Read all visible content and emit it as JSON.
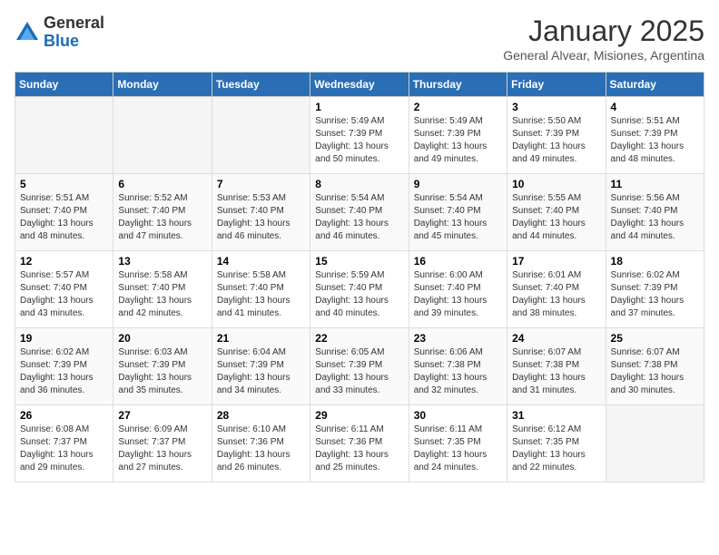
{
  "logo": {
    "general": "General",
    "blue": "Blue"
  },
  "title": "January 2025",
  "subtitle": "General Alvear, Misiones, Argentina",
  "days_of_week": [
    "Sunday",
    "Monday",
    "Tuesday",
    "Wednesday",
    "Thursday",
    "Friday",
    "Saturday"
  ],
  "weeks": [
    [
      {
        "num": "",
        "info": ""
      },
      {
        "num": "",
        "info": ""
      },
      {
        "num": "",
        "info": ""
      },
      {
        "num": "1",
        "info": "Sunrise: 5:49 AM\nSunset: 7:39 PM\nDaylight: 13 hours\nand 50 minutes."
      },
      {
        "num": "2",
        "info": "Sunrise: 5:49 AM\nSunset: 7:39 PM\nDaylight: 13 hours\nand 49 minutes."
      },
      {
        "num": "3",
        "info": "Sunrise: 5:50 AM\nSunset: 7:39 PM\nDaylight: 13 hours\nand 49 minutes."
      },
      {
        "num": "4",
        "info": "Sunrise: 5:51 AM\nSunset: 7:39 PM\nDaylight: 13 hours\nand 48 minutes."
      }
    ],
    [
      {
        "num": "5",
        "info": "Sunrise: 5:51 AM\nSunset: 7:40 PM\nDaylight: 13 hours\nand 48 minutes."
      },
      {
        "num": "6",
        "info": "Sunrise: 5:52 AM\nSunset: 7:40 PM\nDaylight: 13 hours\nand 47 minutes."
      },
      {
        "num": "7",
        "info": "Sunrise: 5:53 AM\nSunset: 7:40 PM\nDaylight: 13 hours\nand 46 minutes."
      },
      {
        "num": "8",
        "info": "Sunrise: 5:54 AM\nSunset: 7:40 PM\nDaylight: 13 hours\nand 46 minutes."
      },
      {
        "num": "9",
        "info": "Sunrise: 5:54 AM\nSunset: 7:40 PM\nDaylight: 13 hours\nand 45 minutes."
      },
      {
        "num": "10",
        "info": "Sunrise: 5:55 AM\nSunset: 7:40 PM\nDaylight: 13 hours\nand 44 minutes."
      },
      {
        "num": "11",
        "info": "Sunrise: 5:56 AM\nSunset: 7:40 PM\nDaylight: 13 hours\nand 44 minutes."
      }
    ],
    [
      {
        "num": "12",
        "info": "Sunrise: 5:57 AM\nSunset: 7:40 PM\nDaylight: 13 hours\nand 43 minutes."
      },
      {
        "num": "13",
        "info": "Sunrise: 5:58 AM\nSunset: 7:40 PM\nDaylight: 13 hours\nand 42 minutes."
      },
      {
        "num": "14",
        "info": "Sunrise: 5:58 AM\nSunset: 7:40 PM\nDaylight: 13 hours\nand 41 minutes."
      },
      {
        "num": "15",
        "info": "Sunrise: 5:59 AM\nSunset: 7:40 PM\nDaylight: 13 hours\nand 40 minutes."
      },
      {
        "num": "16",
        "info": "Sunrise: 6:00 AM\nSunset: 7:40 PM\nDaylight: 13 hours\nand 39 minutes."
      },
      {
        "num": "17",
        "info": "Sunrise: 6:01 AM\nSunset: 7:40 PM\nDaylight: 13 hours\nand 38 minutes."
      },
      {
        "num": "18",
        "info": "Sunrise: 6:02 AM\nSunset: 7:39 PM\nDaylight: 13 hours\nand 37 minutes."
      }
    ],
    [
      {
        "num": "19",
        "info": "Sunrise: 6:02 AM\nSunset: 7:39 PM\nDaylight: 13 hours\nand 36 minutes."
      },
      {
        "num": "20",
        "info": "Sunrise: 6:03 AM\nSunset: 7:39 PM\nDaylight: 13 hours\nand 35 minutes."
      },
      {
        "num": "21",
        "info": "Sunrise: 6:04 AM\nSunset: 7:39 PM\nDaylight: 13 hours\nand 34 minutes."
      },
      {
        "num": "22",
        "info": "Sunrise: 6:05 AM\nSunset: 7:39 PM\nDaylight: 13 hours\nand 33 minutes."
      },
      {
        "num": "23",
        "info": "Sunrise: 6:06 AM\nSunset: 7:38 PM\nDaylight: 13 hours\nand 32 minutes."
      },
      {
        "num": "24",
        "info": "Sunrise: 6:07 AM\nSunset: 7:38 PM\nDaylight: 13 hours\nand 31 minutes."
      },
      {
        "num": "25",
        "info": "Sunrise: 6:07 AM\nSunset: 7:38 PM\nDaylight: 13 hours\nand 30 minutes."
      }
    ],
    [
      {
        "num": "26",
        "info": "Sunrise: 6:08 AM\nSunset: 7:37 PM\nDaylight: 13 hours\nand 29 minutes."
      },
      {
        "num": "27",
        "info": "Sunrise: 6:09 AM\nSunset: 7:37 PM\nDaylight: 13 hours\nand 27 minutes."
      },
      {
        "num": "28",
        "info": "Sunrise: 6:10 AM\nSunset: 7:36 PM\nDaylight: 13 hours\nand 26 minutes."
      },
      {
        "num": "29",
        "info": "Sunrise: 6:11 AM\nSunset: 7:36 PM\nDaylight: 13 hours\nand 25 minutes."
      },
      {
        "num": "30",
        "info": "Sunrise: 6:11 AM\nSunset: 7:35 PM\nDaylight: 13 hours\nand 24 minutes."
      },
      {
        "num": "31",
        "info": "Sunrise: 6:12 AM\nSunset: 7:35 PM\nDaylight: 13 hours\nand 22 minutes."
      },
      {
        "num": "",
        "info": ""
      }
    ]
  ]
}
